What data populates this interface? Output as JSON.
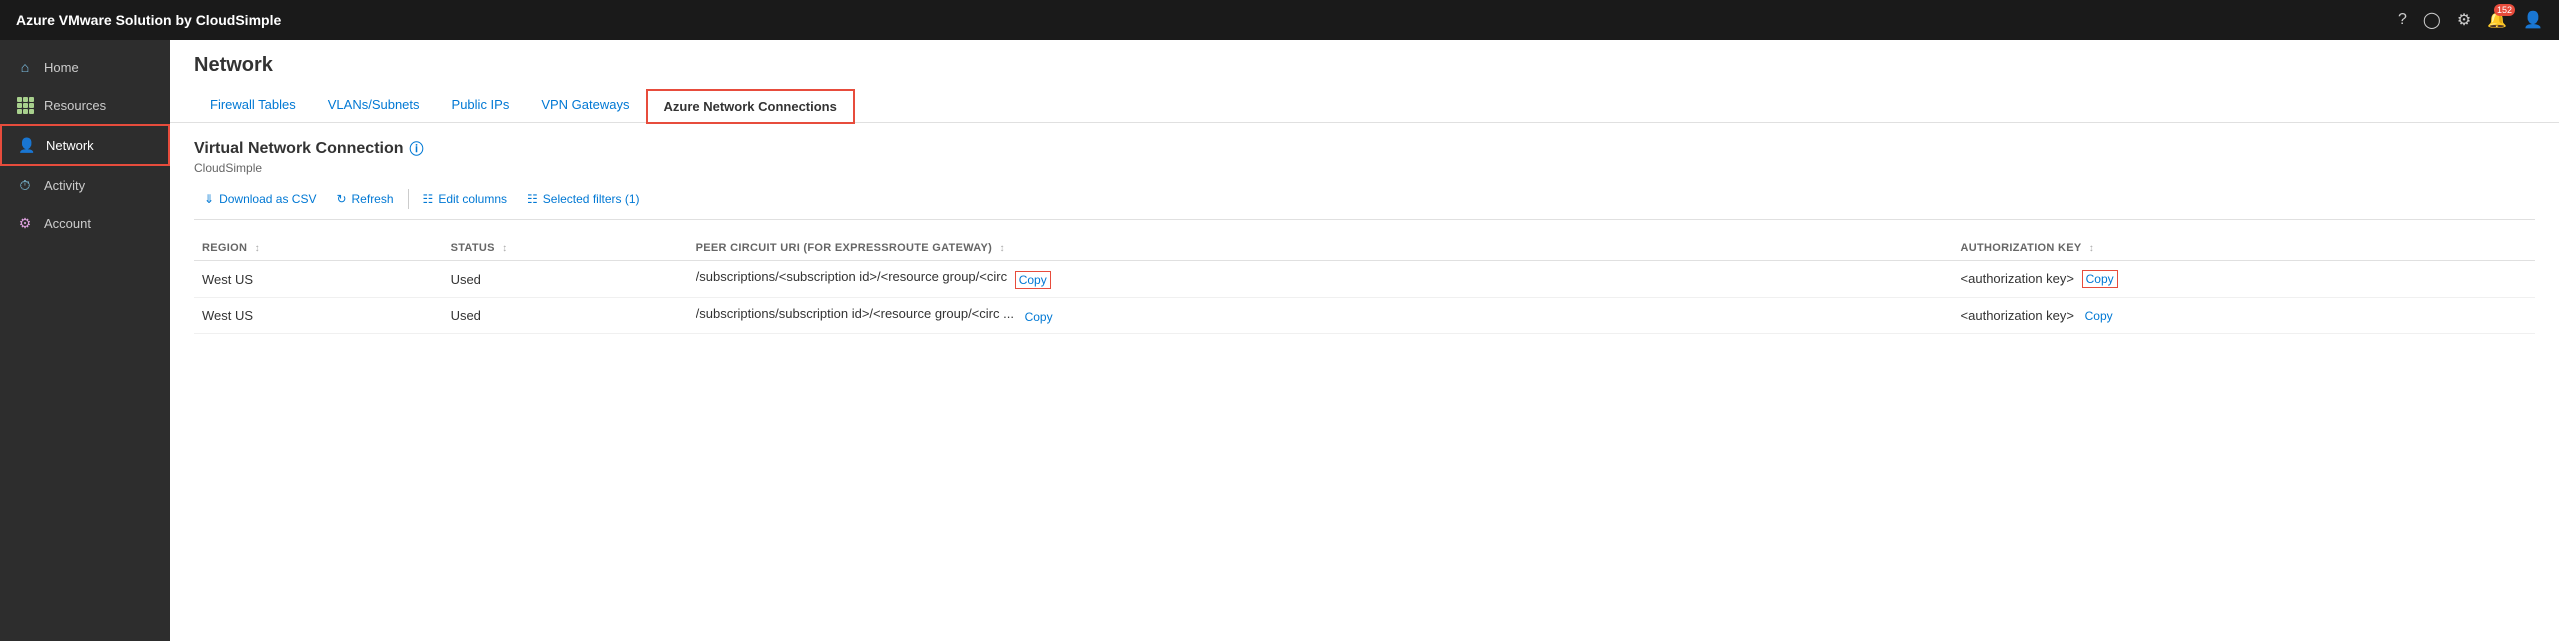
{
  "app": {
    "brand": "Azure VMware Solution by CloudSimple"
  },
  "topbar": {
    "icons": [
      "help-icon",
      "user-icon",
      "settings-icon",
      "bell-icon",
      "account-icon"
    ],
    "bell_count": "152"
  },
  "sidebar": {
    "items": [
      {
        "id": "home",
        "label": "Home",
        "icon": "home"
      },
      {
        "id": "resources",
        "label": "Resources",
        "icon": "resources"
      },
      {
        "id": "network",
        "label": "Network",
        "icon": "network",
        "active": true
      },
      {
        "id": "activity",
        "label": "Activity",
        "icon": "activity"
      },
      {
        "id": "account",
        "label": "Account",
        "icon": "account"
      }
    ]
  },
  "page": {
    "title": "Network",
    "tabs": [
      {
        "id": "firewall",
        "label": "Firewall Tables"
      },
      {
        "id": "vlans",
        "label": "VLANs/Subnets"
      },
      {
        "id": "publicips",
        "label": "Public IPs"
      },
      {
        "id": "vpn",
        "label": "VPN Gateways"
      },
      {
        "id": "azurenet",
        "label": "Azure Network Connections",
        "active": true
      }
    ]
  },
  "section": {
    "title": "Virtual Network Connection",
    "subtitle": "CloudSimple"
  },
  "toolbar": {
    "download_label": "Download as CSV",
    "refresh_label": "Refresh",
    "edit_columns_label": "Edit columns",
    "selected_filters_label": "Selected filters (1)"
  },
  "table": {
    "columns": [
      {
        "id": "region",
        "label": "REGION"
      },
      {
        "id": "status",
        "label": "STATUS"
      },
      {
        "id": "peer_circuit",
        "label": "PEER CIRCUIT URI (FOR EXPRESSROUTE GATEWAY)"
      },
      {
        "id": "auth_key",
        "label": "AUTHORIZATION KEY"
      }
    ],
    "rows": [
      {
        "region": "West US",
        "status": "Used",
        "peer_circuit": "/subscriptions/<subscription id>/<resource group/<circ",
        "peer_circuit_full": "/subscriptions/<subscription id>/<resource group/<circuit>",
        "auth_key": "<authorization key>",
        "copy_peer_outlined": true,
        "copy_auth_outlined": true
      },
      {
        "region": "West US",
        "status": "Used",
        "peer_circuit": "/subscriptions/subscription id>/<resource group/<circ ...",
        "peer_circuit_full": "/subscriptions/subscription id>/<resource group/<circuit>",
        "auth_key": "<authorization key>",
        "copy_peer_outlined": false,
        "copy_auth_outlined": false
      }
    ]
  }
}
